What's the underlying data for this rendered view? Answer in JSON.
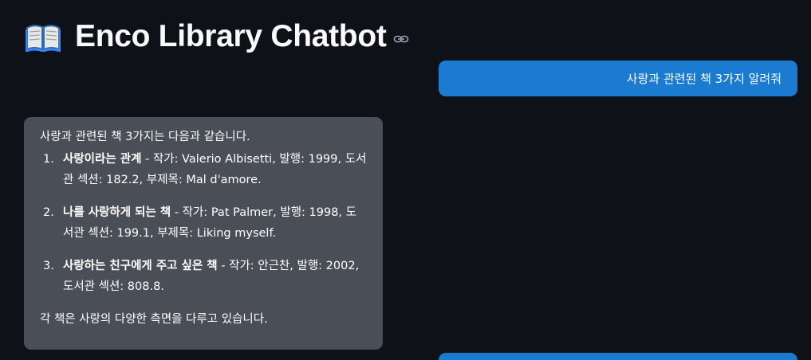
{
  "header": {
    "title": "Enco Library Chatbot",
    "title_icon": "open-book-icon",
    "anchor_icon": "link-icon"
  },
  "colors": {
    "background": "#0e1117",
    "user_bubble": "#1a7bd0",
    "assistant_bubble": "#4a4f57",
    "text": "#fafafa"
  },
  "messages": {
    "user_1": "사랑과 관련된 책 3가지 알려줘",
    "assistant_1": {
      "intro": "사랑과 관련된 책 3가지는 다음과 같습니다.",
      "items": [
        {
          "number": "1.",
          "title": "사랑이라는 관계",
          "details": " - 작가: Valerio Albisetti, 발행: 1999, 도서관 섹션: 182.2, 부제목: Mal d'amore."
        },
        {
          "number": "2.",
          "title": "나를 사랑하게 되는 책",
          "details": " - 작가: Pat Palmer, 발행: 1998, 도서관 섹션: 199.1, 부제목: Liking myself."
        },
        {
          "number": "3.",
          "title": "사랑하는 친구에게 주고 싶은 책",
          "details": " - 작가: 안근찬, 발행: 2002, 도서관 섹션: 808.8."
        }
      ],
      "outro": "각 책은 사랑의 다양한 측면을 다루고 있습니다."
    }
  }
}
